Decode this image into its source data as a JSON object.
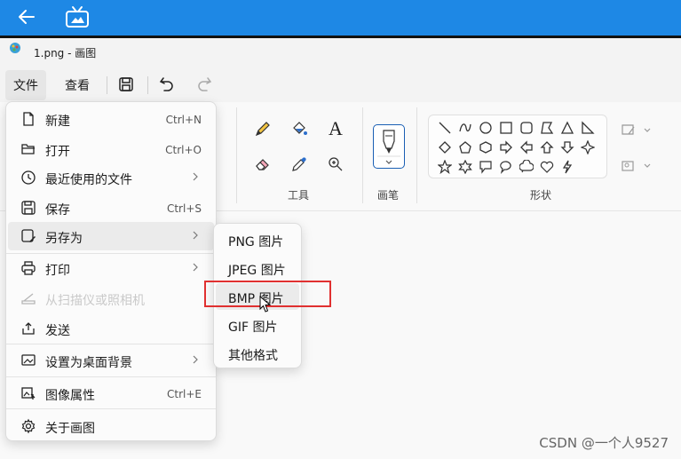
{
  "window": {
    "title": "1.png - 画图"
  },
  "menubar": {
    "file": "文件",
    "view": "查看"
  },
  "ribbon": {
    "tools_label": "工具",
    "brush_label": "画笔",
    "shapes_label": "形状",
    "text_tool": "A"
  },
  "file_menu": {
    "items": [
      {
        "label": "新建",
        "shortcut": "Ctrl+N"
      },
      {
        "label": "打开",
        "shortcut": "Ctrl+O"
      },
      {
        "label": "最近使用的文件",
        "shortcut": ""
      },
      {
        "label": "保存",
        "shortcut": "Ctrl+S"
      },
      {
        "label": "另存为",
        "shortcut": ""
      },
      {
        "label": "打印",
        "shortcut": ""
      },
      {
        "label": "从扫描仪或照相机",
        "shortcut": ""
      },
      {
        "label": "发送",
        "shortcut": ""
      },
      {
        "label": "设置为桌面背景",
        "shortcut": ""
      },
      {
        "label": "图像属性",
        "shortcut": "Ctrl+E"
      },
      {
        "label": "关于画图",
        "shortcut": ""
      }
    ]
  },
  "save_as_submenu": {
    "items": [
      {
        "label": "PNG 图片"
      },
      {
        "label": "JPEG 图片"
      },
      {
        "label": "BMP 图片"
      },
      {
        "label": "GIF 图片"
      },
      {
        "label": "其他格式"
      }
    ]
  },
  "watermark": "CSDN @一个人9527",
  "colors": {
    "topbar": "#1e88e5",
    "highlight": "#e03030",
    "accent": "#1a5fb4"
  }
}
